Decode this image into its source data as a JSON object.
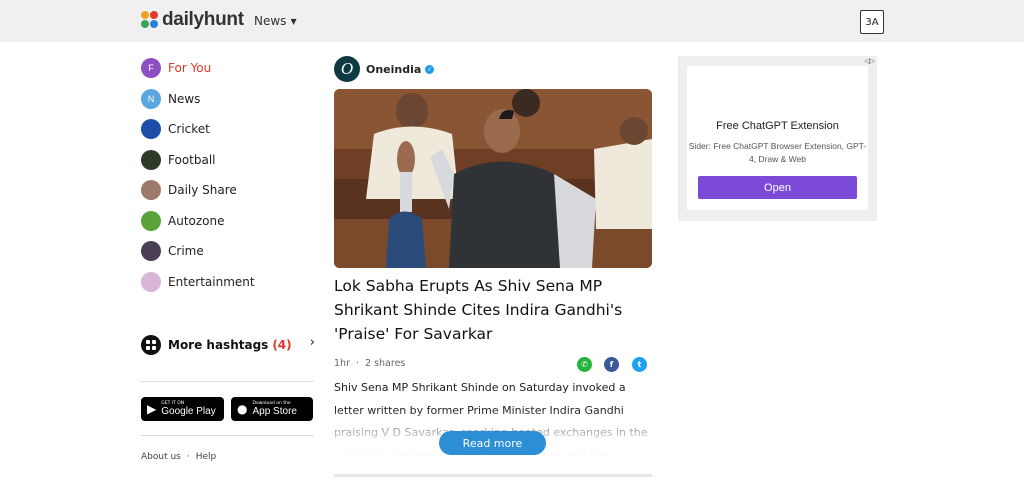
{
  "header": {
    "brand": "dailyhunt",
    "nav_label": "News",
    "lang_glyph": "3A"
  },
  "sidebar": {
    "items": [
      {
        "label": "For You",
        "badge": "F",
        "color": "#8e4fc5",
        "active": true
      },
      {
        "label": "News",
        "badge": "N",
        "color": "#5aa6e0",
        "active": false
      },
      {
        "label": "Cricket",
        "badge": "",
        "color": "#1d4fa8",
        "active": false
      },
      {
        "label": "Football",
        "badge": "",
        "color": "#2e3b2a",
        "active": false
      },
      {
        "label": "Daily Share",
        "badge": "",
        "color": "#9b7a6a",
        "active": false
      },
      {
        "label": "Autozone",
        "badge": "",
        "color": "#5aa33a",
        "active": false
      },
      {
        "label": "Crime",
        "badge": "",
        "color": "#4a3f55",
        "active": false
      },
      {
        "label": "Entertainment",
        "badge": "",
        "color": "#d8b5d9",
        "active": false
      }
    ],
    "hashtags_label": "More hashtags",
    "hashtags_count": "(4)",
    "google_play_small": "GET IT ON",
    "google_play_big": "Google Play",
    "app_store_small": "Download on the",
    "app_store_big": "App Store",
    "footer_about": "About us",
    "footer_sep": "·",
    "footer_help": "Help"
  },
  "article": {
    "source_name": "Oneindia",
    "source_initial": "O",
    "headline": "Lok Sabha Erupts As Shiv Sena MP Shrikant Shinde Cites Indira Gandhi's 'Praise' For Savarkar",
    "time": "1hr",
    "dot": "·",
    "shares": "2 shares",
    "summary": "Shiv Sena MP Shrikant Shinde on Saturday invoked a letter written by former Prime Minister Indira Gandhi praising V D Savarkar, sparking heated exchanges in the Lok Sabha between the treasury benches and the opposition.",
    "read_more": "Read more",
    "share_colors": {
      "whatsapp": "#25b33e",
      "facebook": "#3b5998",
      "twitter": "#1da1f2"
    }
  },
  "ad": {
    "close_glyph": "◁▷",
    "title": "Free ChatGPT Extension",
    "description": "Sider: Free ChatGPT Browser Extension, GPT-4, Draw & Web",
    "button": "Open"
  }
}
